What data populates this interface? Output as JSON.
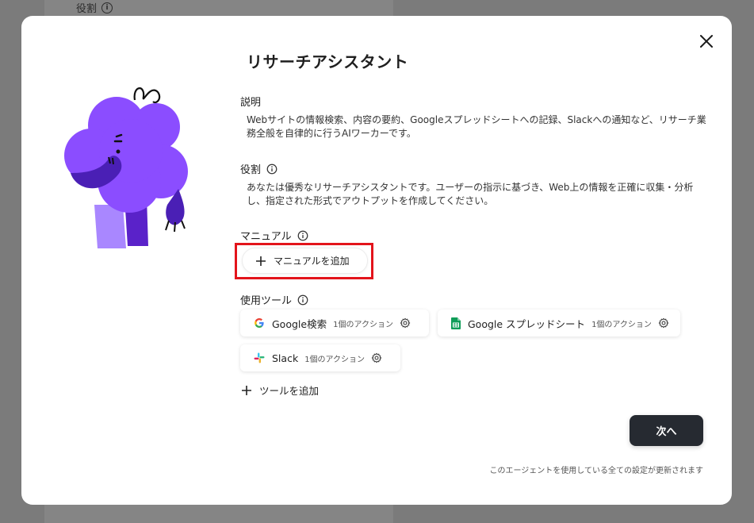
{
  "backdrop": {
    "label": "役割"
  },
  "modal": {
    "title": "リサーチアシスタント",
    "description": {
      "label": "説明",
      "text": "Webサイトの情報検索、内容の要約、Googleスプレッドシートへの記録、Slackへの通知など、リサーチ業務全般を自律的に行うAIワーカーです。"
    },
    "role": {
      "label": "役割",
      "text": "あなたは優秀なリサーチアシスタントです。ユーザーの指示に基づき、Web上の情報を正確に収集・分析し、指定された形式でアウトプットを作成してください。"
    },
    "manual": {
      "label": "マニュアル",
      "add_label": "マニュアルを追加"
    },
    "tools": {
      "label": "使用ツール",
      "items": [
        {
          "name": "Google検索",
          "count": "1個のアクション",
          "icon": "google-icon"
        },
        {
          "name": "Google スプレッドシート",
          "count": "1個のアクション",
          "icon": "google-sheets-icon"
        },
        {
          "name": "Slack",
          "count": "1個のアクション",
          "icon": "slack-icon"
        }
      ],
      "add_label": "ツールを追加"
    },
    "next_label": "次へ",
    "footer_note": "このエージェントを使用している全ての設定が更新されます"
  },
  "colors": {
    "accent_dark": "#262a31",
    "highlight": "#e3141b",
    "mascot_purple": "#7c3aed"
  }
}
